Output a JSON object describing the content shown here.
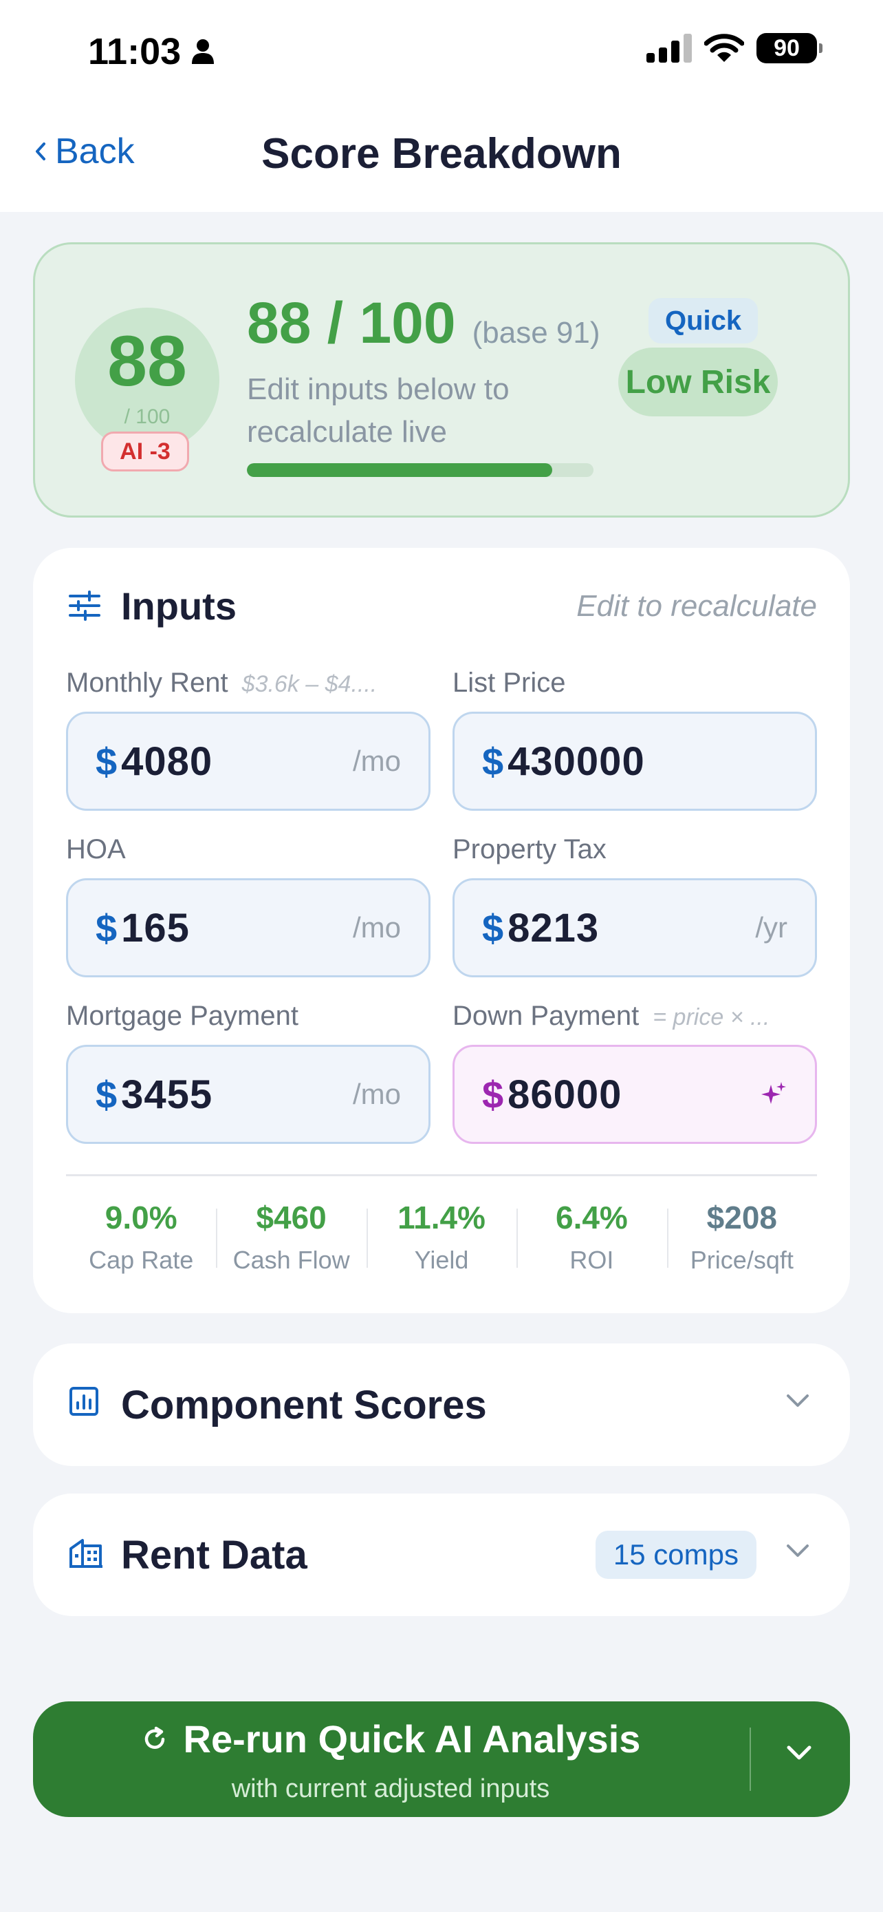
{
  "status_bar": {
    "time": "11:03",
    "battery": "90"
  },
  "nav": {
    "back_label": "Back",
    "title": "Score Breakdown"
  },
  "score": {
    "circle_value": "88",
    "circle_max": "/ 100",
    "ai_adjustment": "AI -3",
    "main_value": "88 / 100",
    "base": "(base 91)",
    "mode": "Quick",
    "risk": "Low Risk",
    "hint": "Edit inputs below to recalculate live",
    "progress_fraction": 0.88,
    "color": "#43A047"
  },
  "inputs": {
    "title": "Inputs",
    "hint": "Edit to recalculate",
    "fields": {
      "monthly_rent": {
        "label": "Monthly Rent",
        "sub": "$3.6k – $4....",
        "currency": "$",
        "value": "4080",
        "unit": "/mo"
      },
      "list_price": {
        "label": "List Price",
        "currency": "$",
        "value": "430000"
      },
      "hoa": {
        "label": "HOA",
        "currency": "$",
        "value": "165",
        "unit": "/mo"
      },
      "property_tax": {
        "label": "Property Tax",
        "currency": "$",
        "value": "8213",
        "unit": "/yr"
      },
      "mortgage": {
        "label": "Mortgage Payment",
        "currency": "$",
        "value": "3455",
        "unit": "/mo"
      },
      "down_payment": {
        "label": "Down Payment",
        "sub": "= price × ...",
        "currency": "$",
        "value": "86000",
        "icon": "sparkle-icon"
      }
    },
    "metrics": [
      {
        "value": "9.0%",
        "label": "Cap Rate"
      },
      {
        "value": "$460",
        "label": "Cash Flow"
      },
      {
        "value": "11.4%",
        "label": "Yield"
      },
      {
        "value": "6.4%",
        "label": "ROI"
      },
      {
        "value": "$208",
        "label": "Price/sqft"
      }
    ]
  },
  "component_scores": {
    "title": "Component Scores",
    "icon": "bar-chart-icon"
  },
  "rent_data": {
    "title": "Rent Data",
    "icon": "buildings-icon",
    "comps": "15 comps"
  },
  "rerun": {
    "label": "Re-run Quick AI Analysis",
    "sub": "with current adjusted inputs",
    "icon": "refresh-icon"
  },
  "colors": {
    "accent_blue": "#1565C0",
    "green": "#43A047",
    "dark_green": "#2E7D32",
    "purple": "#9C27B0"
  }
}
